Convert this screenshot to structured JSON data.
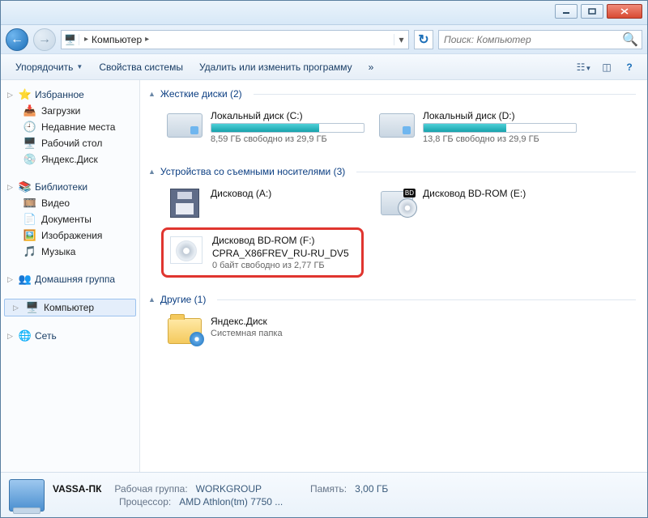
{
  "titlebar": {
    "min": "",
    "max": "",
    "close": ""
  },
  "nav": {
    "breadcrumb_icon": "computer-icon",
    "breadcrumb": [
      "Компьютер"
    ],
    "search_placeholder": "Поиск: Компьютер"
  },
  "toolbar": {
    "organize": "Упорядочить",
    "properties": "Свойства системы",
    "uninstall": "Удалить или изменить программу",
    "overflow": "»"
  },
  "sidebar": {
    "favorites": {
      "label": "Избранное",
      "items": [
        "Загрузки",
        "Недавние места",
        "Рабочий стол",
        "Яндекс.Диск"
      ]
    },
    "libraries": {
      "label": "Библиотеки",
      "items": [
        "Видео",
        "Документы",
        "Изображения",
        "Музыка"
      ]
    },
    "homegroup": {
      "label": "Домашняя группа"
    },
    "computer": {
      "label": "Компьютер"
    },
    "network": {
      "label": "Сеть"
    }
  },
  "groups": {
    "hdd": {
      "title": "Жесткие диски (2)",
      "drives": [
        {
          "name": "Локальный диск (C:)",
          "free_text": "8,59 ГБ свободно из 29,9 ГБ",
          "fill_pct": 71
        },
        {
          "name": "Локальный диск (D:)",
          "free_text": "13,8 ГБ свободно из 29,9 ГБ",
          "fill_pct": 54
        }
      ]
    },
    "removable": {
      "title": "Устройства со съемными носителями (3)",
      "drives": [
        {
          "name": "Дисковод (A:)",
          "type": "floppy"
        },
        {
          "name": "Дисковод BD-ROM (E:)",
          "type": "bd"
        },
        {
          "name": "Дисковод BD-ROM (F:)",
          "sub": "CPRA_X86FREV_RU-RU_DV5",
          "free_text": "0 байт свободно из 2,77 ГБ",
          "type": "disc",
          "highlight": true
        }
      ]
    },
    "other": {
      "title": "Другие (1)",
      "drives": [
        {
          "name": "Яндекс.Диск",
          "sub": "Системная папка",
          "type": "folder"
        }
      ]
    }
  },
  "statusbar": {
    "name": "VASSA-ПК",
    "workgroup_label": "Рабочая группа:",
    "workgroup": "WORKGROUP",
    "memory_label": "Память:",
    "memory": "3,00 ГБ",
    "cpu_label": "Процессор:",
    "cpu": "AMD Athlon(tm) 7750 ..."
  }
}
